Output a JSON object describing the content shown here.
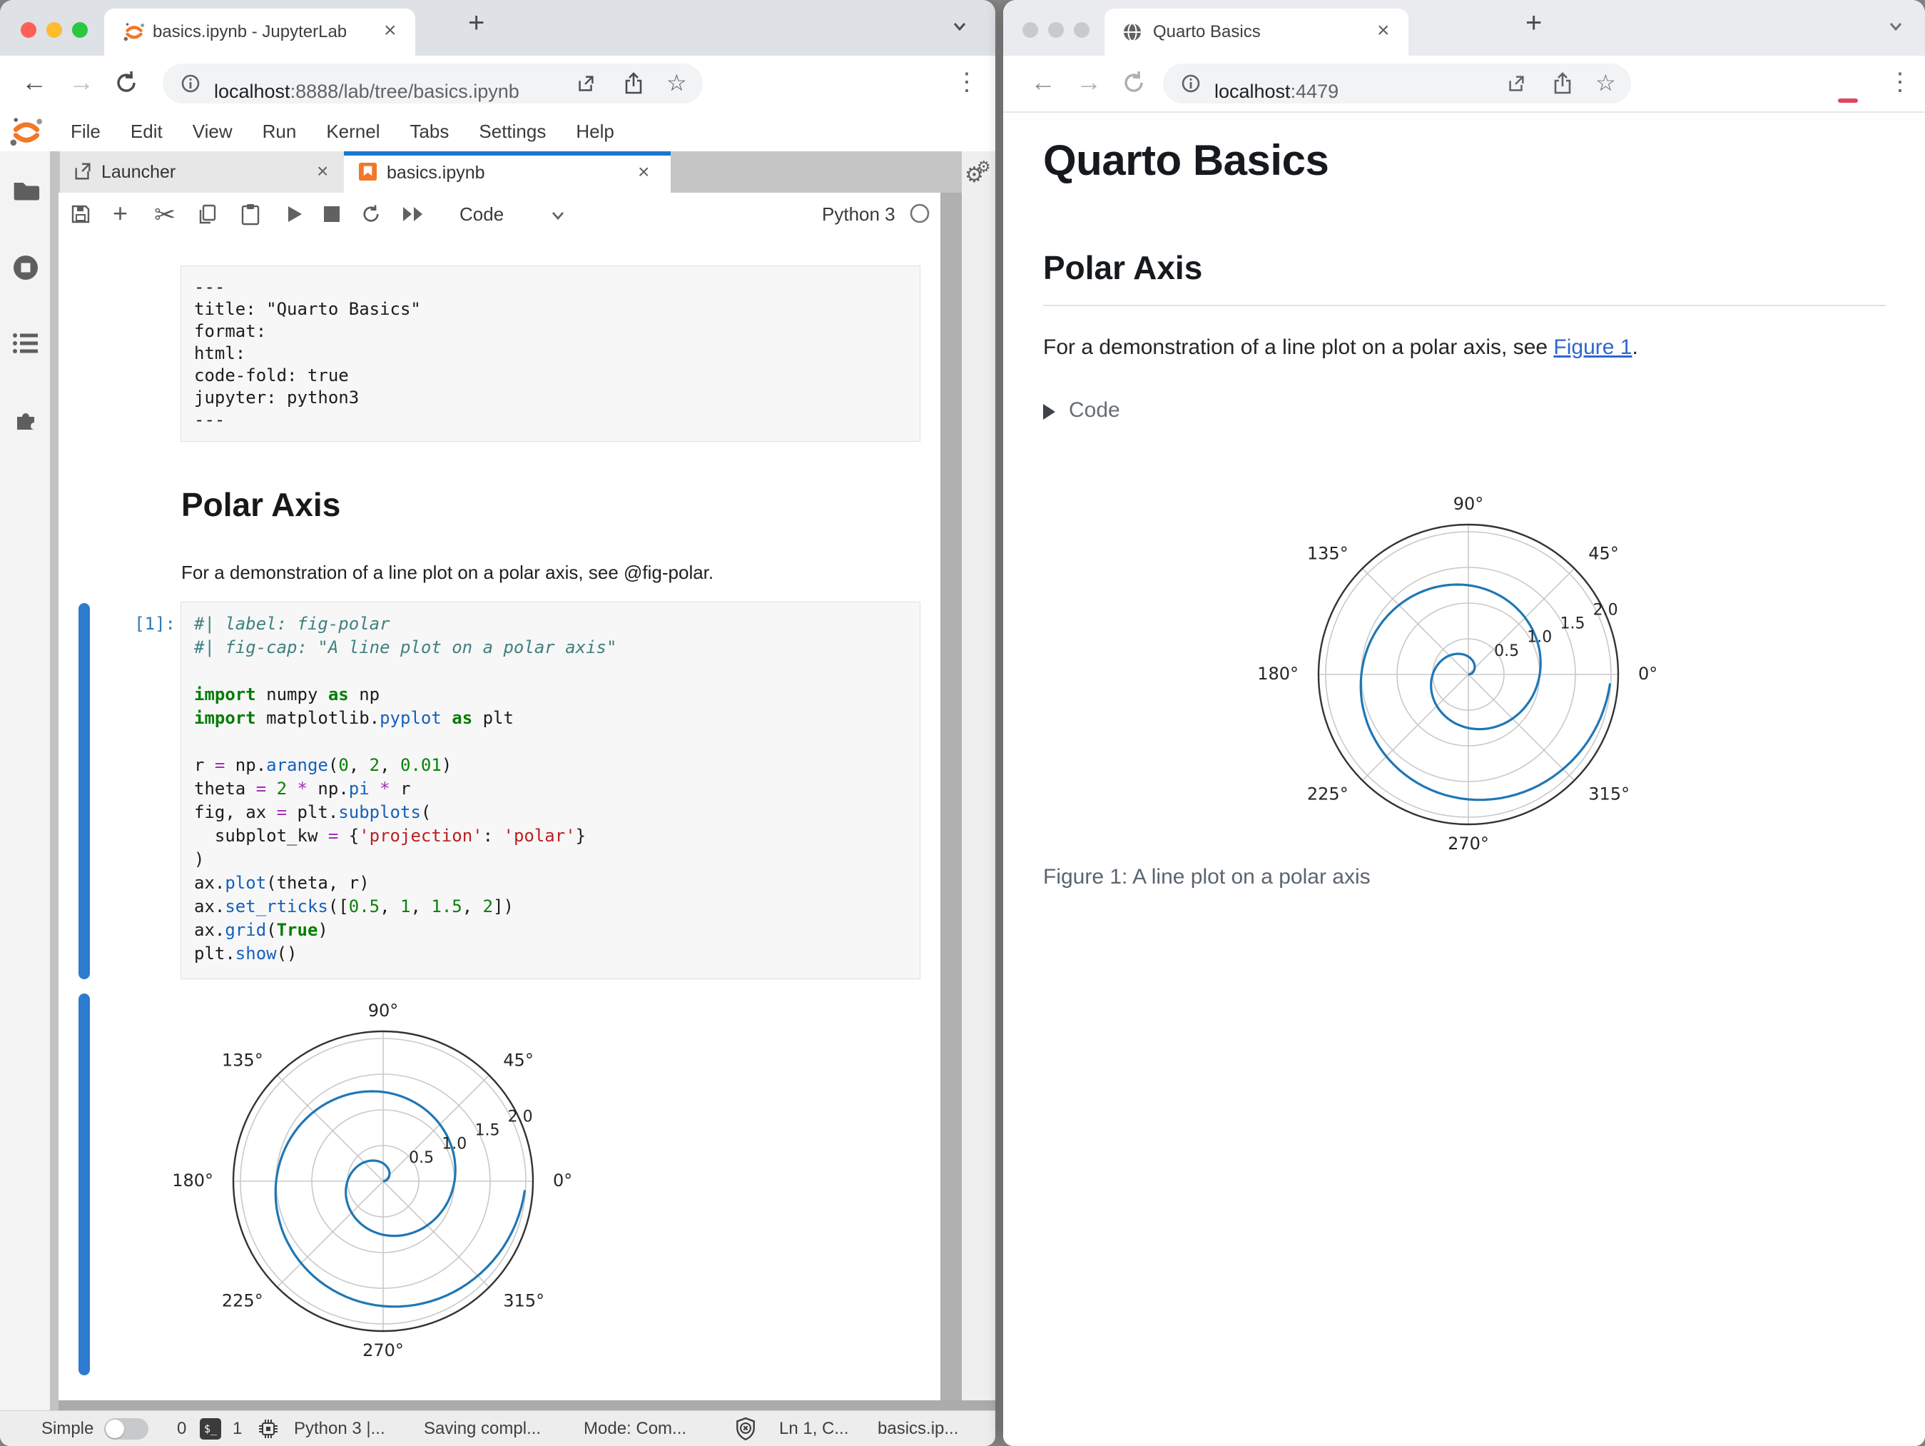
{
  "colors": {
    "brand_orange": "#F37726",
    "active_tab_border": "#1976d2",
    "collapser_blue": "#2e7bcf",
    "link_blue": "#2f66d0"
  },
  "left_window": {
    "browser": {
      "tab_title": "basics.ipynb - JupyterLab",
      "url_host": "localhost",
      "url_rest": ":8888/lab/tree/basics.ipynb"
    },
    "menu": [
      "File",
      "Edit",
      "View",
      "Run",
      "Kernel",
      "Tabs",
      "Settings",
      "Help"
    ],
    "dock": {
      "tab_launcher": "Launcher",
      "tab_notebook": "basics.ipynb"
    },
    "toolbar": {
      "cell_type": "Code",
      "kernel_name": "Python 3"
    },
    "notebook": {
      "raw_cell_lines": [
        "---",
        "title: \"Quarto Basics\"",
        "format:",
        "  html:",
        "    code-fold: true",
        "jupyter: python3",
        "---"
      ],
      "heading": "Polar Axis",
      "paragraph": "For a demonstration of a line plot on a polar axis, see @fig-polar.",
      "execution_prompt": "[1]:",
      "code_lines": [
        [
          [
            "cm",
            "#| label: fig-polar"
          ]
        ],
        [
          [
            "cm",
            "#| fig-cap: \"A line plot on a polar axis\""
          ]
        ],
        [],
        [
          [
            "kw",
            "import"
          ],
          [
            "pl",
            " numpy "
          ],
          [
            "kw",
            "as"
          ],
          [
            "pl",
            " np"
          ]
        ],
        [
          [
            "kw",
            "import"
          ],
          [
            "pl",
            " matplotlib."
          ],
          [
            "fn",
            "pyplot"
          ],
          [
            "pl",
            " "
          ],
          [
            "kw",
            "as"
          ],
          [
            "pl",
            " plt"
          ]
        ],
        [],
        [
          [
            "pl",
            "r "
          ],
          [
            "op",
            "="
          ],
          [
            "pl",
            " np."
          ],
          [
            "fn",
            "arange"
          ],
          [
            "pl",
            "("
          ],
          [
            "num",
            "0"
          ],
          [
            "pl",
            ", "
          ],
          [
            "num",
            "2"
          ],
          [
            "pl",
            ", "
          ],
          [
            "num",
            "0.01"
          ],
          [
            "pl",
            ")"
          ]
        ],
        [
          [
            "pl",
            "theta "
          ],
          [
            "op",
            "="
          ],
          [
            "pl",
            " "
          ],
          [
            "num",
            "2"
          ],
          [
            "pl",
            " "
          ],
          [
            "op",
            "*"
          ],
          [
            "pl",
            " np."
          ],
          [
            "fn",
            "pi"
          ],
          [
            "pl",
            " "
          ],
          [
            "op",
            "*"
          ],
          [
            "pl",
            " r"
          ]
        ],
        [
          [
            "pl",
            "fig, ax "
          ],
          [
            "op",
            "="
          ],
          [
            "pl",
            " plt."
          ],
          [
            "fn",
            "subplots"
          ],
          [
            "pl",
            "("
          ]
        ],
        [
          [
            "pl",
            "  subplot_kw "
          ],
          [
            "op",
            "="
          ],
          [
            "pl",
            " {"
          ],
          [
            "str",
            "'projection'"
          ],
          [
            "pl",
            ": "
          ],
          [
            "str",
            "'polar'"
          ],
          [
            "pl",
            "}"
          ]
        ],
        [
          [
            "pl",
            ")"
          ]
        ],
        [
          [
            "pl",
            "ax."
          ],
          [
            "fn",
            "plot"
          ],
          [
            "pl",
            "(theta, r)"
          ]
        ],
        [
          [
            "pl",
            "ax."
          ],
          [
            "fn",
            "set_rticks"
          ],
          [
            "pl",
            "(["
          ],
          [
            "num",
            "0.5"
          ],
          [
            "pl",
            ", "
          ],
          [
            "num",
            "1"
          ],
          [
            "pl",
            ", "
          ],
          [
            "num",
            "1.5"
          ],
          [
            "pl",
            ", "
          ],
          [
            "num",
            "2"
          ],
          [
            "pl",
            "])"
          ]
        ],
        [
          [
            "pl",
            "ax."
          ],
          [
            "fn",
            "grid"
          ],
          [
            "pl",
            "("
          ],
          [
            "kw",
            "True"
          ],
          [
            "pl",
            ")"
          ]
        ],
        [
          [
            "pl",
            "plt."
          ],
          [
            "fn",
            "show"
          ],
          [
            "pl",
            "()"
          ]
        ]
      ]
    },
    "statusbar": {
      "mode_toggle_label": "Simple",
      "terminals_count": "0",
      "kernels_count": "1",
      "kernel_status": "Python 3 |...",
      "saving_status": "Saving compl...",
      "mode": "Mode: Com...",
      "cursor_position": "Ln 1, C...",
      "filename": "basics.ip..."
    }
  },
  "right_window": {
    "browser": {
      "tab_title": "Quarto Basics",
      "url_host": "localhost",
      "url_rest": ":4479"
    },
    "page": {
      "title": "Quarto Basics",
      "section_heading": "Polar Axis",
      "paragraph_prefix": "For a demonstration of a line plot on a polar axis, see ",
      "link_text": "Figure 1",
      "paragraph_suffix": ".",
      "code_fold_label": "Code",
      "figure_caption": "Figure 1: A line plot on a polar axis"
    }
  },
  "chart_data": {
    "type": "line",
    "projection": "polar",
    "title": "",
    "series": [
      {
        "name": "spiral: r from 0 to 2 (step 0.01), theta = 2*pi*r",
        "r": {
          "start": 0,
          "stop": 2,
          "step": 0.01
        },
        "theta_expr": "2 * pi * r"
      }
    ],
    "rticks": [
      0.5,
      1.0,
      1.5,
      2.0
    ],
    "rtick_labels": [
      "0.5",
      "1.0",
      "1.5",
      "2.0"
    ],
    "rmax": 2.1,
    "rlabel_angle_deg": 22.5,
    "theta_ticks_deg": [
      0,
      45,
      90,
      135,
      180,
      225,
      270,
      315
    ],
    "theta_tick_labels": [
      "0°",
      "45°",
      "90°",
      "135°",
      "180°",
      "225°",
      "270°",
      "315°"
    ],
    "grid": true,
    "line_color": "#1f77b4",
    "grid_color": "#c9c9c9",
    "spine_color": "#333333",
    "label_color": "#262626"
  }
}
